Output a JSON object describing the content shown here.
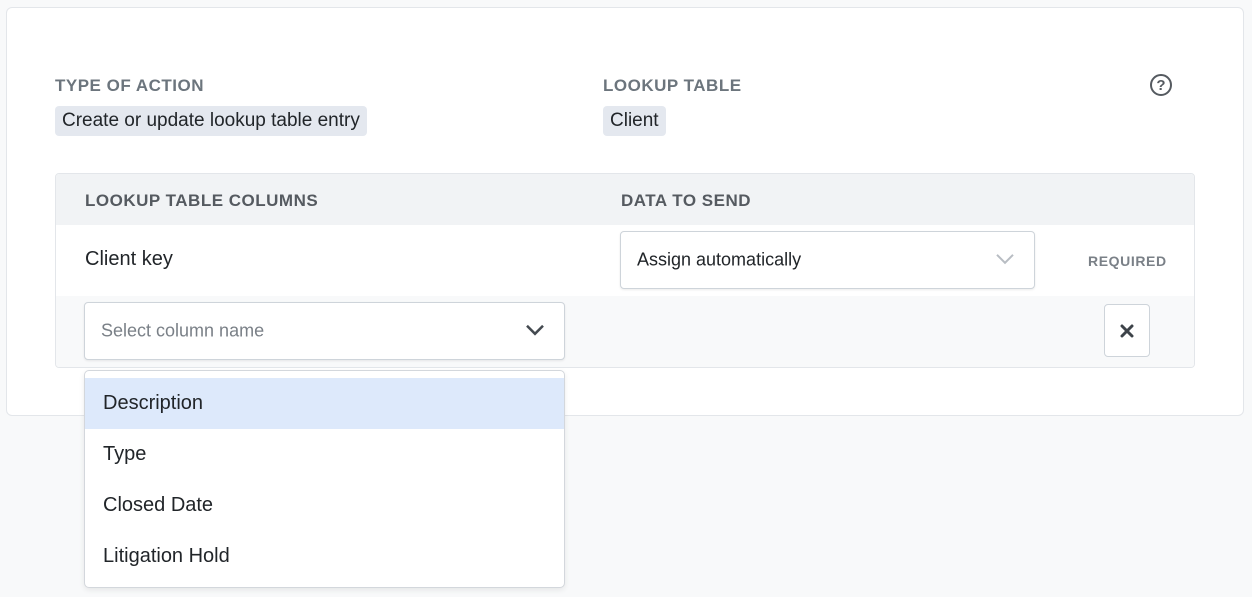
{
  "action": {
    "type_label": "TYPE OF ACTION",
    "type_value": "Create or update lookup table entry",
    "table_label": "LOOKUP TABLE",
    "table_value": "Client",
    "help_glyph": "?"
  },
  "mapping": {
    "col_header": "LOOKUP TABLE COLUMNS",
    "data_header": "DATA TO SEND",
    "rows": [
      {
        "column": "Client key",
        "data": "Assign automatically",
        "badge": "REQUIRED"
      }
    ],
    "new_row": {
      "placeholder": "Select column name",
      "remove_glyph": "✖"
    }
  },
  "dropdown": {
    "options": [
      "Description",
      "Type",
      "Closed Date",
      "Litigation Hold"
    ],
    "highlighted": "Description"
  },
  "colors": {
    "highlight": "#dde9fb",
    "chip": "#e4e8ef"
  }
}
